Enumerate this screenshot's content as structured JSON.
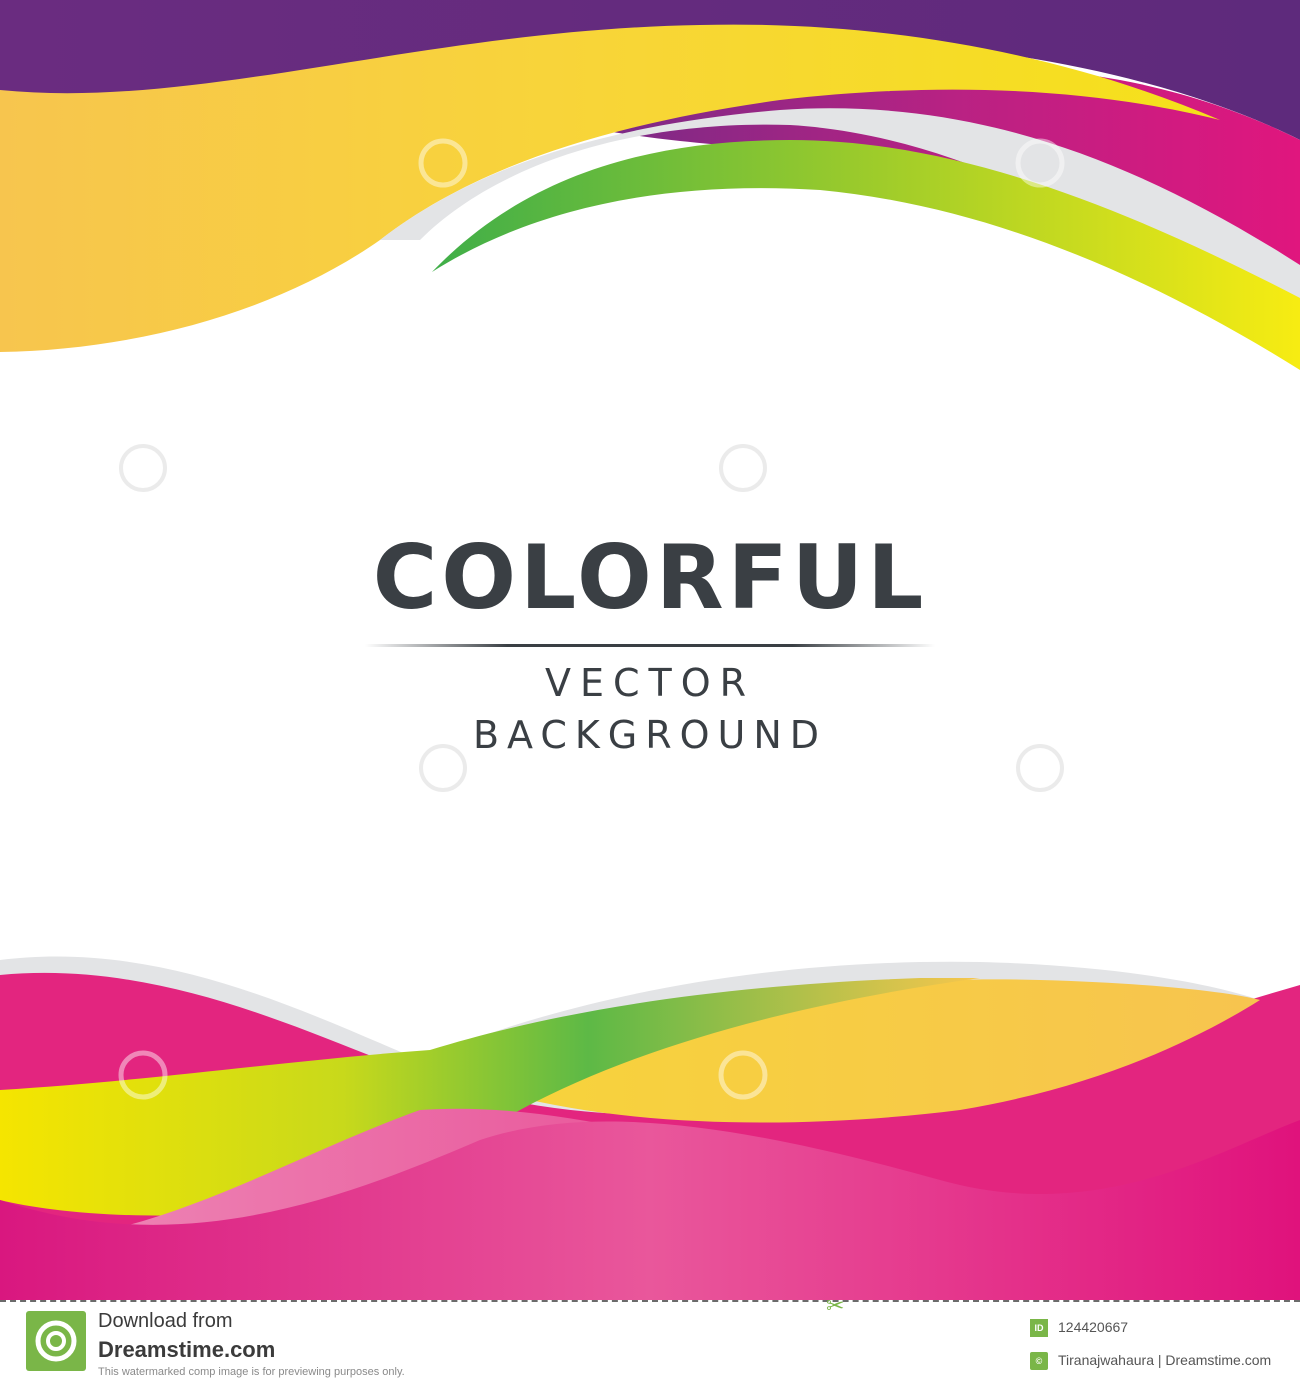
{
  "title": {
    "main": "COLORFUL",
    "line1": "VECTOR",
    "line2": "BACKGROUND"
  },
  "watermark": {
    "text": "dreamstime"
  },
  "footer": {
    "download_label": "Download from",
    "site_name": "Dreamstime.com",
    "notice": "This watermarked comp image is for previewing purposes only.",
    "id_badge": "ID",
    "image_id": "124420667",
    "credit": "Tiranajwahaura | Dreamstime.com"
  },
  "colors": {
    "purple": "#6a2c80",
    "magenta": "#d9177f",
    "pink": "#e9579b",
    "light_pink": "#ee9fc4",
    "yellow": "#f5e11a",
    "orange_yellow": "#f7c54e",
    "green": "#3fae49",
    "lime": "#c2d81c",
    "text_dark": "#3a3f44",
    "brand_green": "#7ab648"
  }
}
